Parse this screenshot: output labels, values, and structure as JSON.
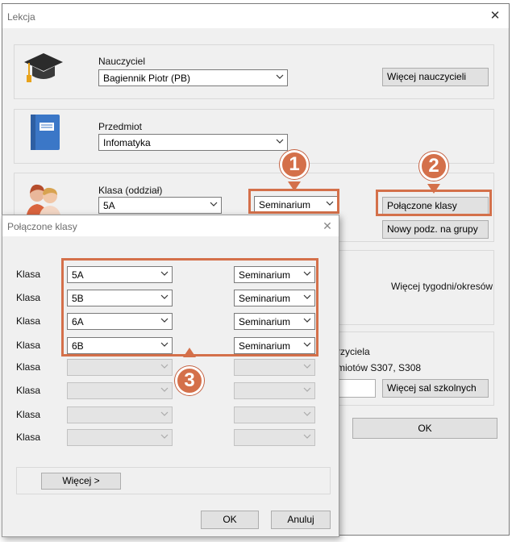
{
  "main_window": {
    "title": "Lekcja",
    "teacher": {
      "label": "Nauczyciel",
      "value": "Bagiennik Piotr (PB)",
      "more_button": "Więcej nauczycieli"
    },
    "subject": {
      "label": "Przedmiot",
      "value": "Infomatyka"
    },
    "class": {
      "label": "Klasa (oddział)",
      "value": "5A",
      "type_value": "Seminarium",
      "linked_button": "Połączone klasy",
      "split_button": "Nowy podz. na grupy"
    },
    "weeks_button": "Więcej tygodni/okresów",
    "room": {
      "label_partial": "rzyciela",
      "rooms_partial": "miotów S307, S308",
      "more_button": "Więcej sal szkolnych"
    },
    "ok_button": "OK"
  },
  "sub_dialog": {
    "title": "Połączone klasy",
    "row_label": "Klasa",
    "rows": [
      {
        "class": "5A",
        "type": "Seminarium",
        "enabled": true
      },
      {
        "class": "5B",
        "type": "Seminarium",
        "enabled": true
      },
      {
        "class": "6A",
        "type": "Seminarium",
        "enabled": true
      },
      {
        "class": "6B",
        "type": "Seminarium",
        "enabled": true
      },
      {
        "class": "",
        "type": "",
        "enabled": false
      },
      {
        "class": "",
        "type": "",
        "enabled": false
      },
      {
        "class": "",
        "type": "",
        "enabled": false
      },
      {
        "class": "",
        "type": "",
        "enabled": false
      }
    ],
    "more_button": "Więcej >",
    "ok_button": "OK",
    "cancel_button": "Anuluj"
  },
  "annotations": {
    "badge1": "1",
    "badge2": "2",
    "badge3": "3"
  },
  "colors": {
    "highlight": "#d4704a",
    "dialog_bg": "#f0f0f0"
  },
  "icons": [
    "graduation-cap-icon",
    "book-icon",
    "students-icon",
    "close-icon",
    "chevron-down-icon"
  ]
}
